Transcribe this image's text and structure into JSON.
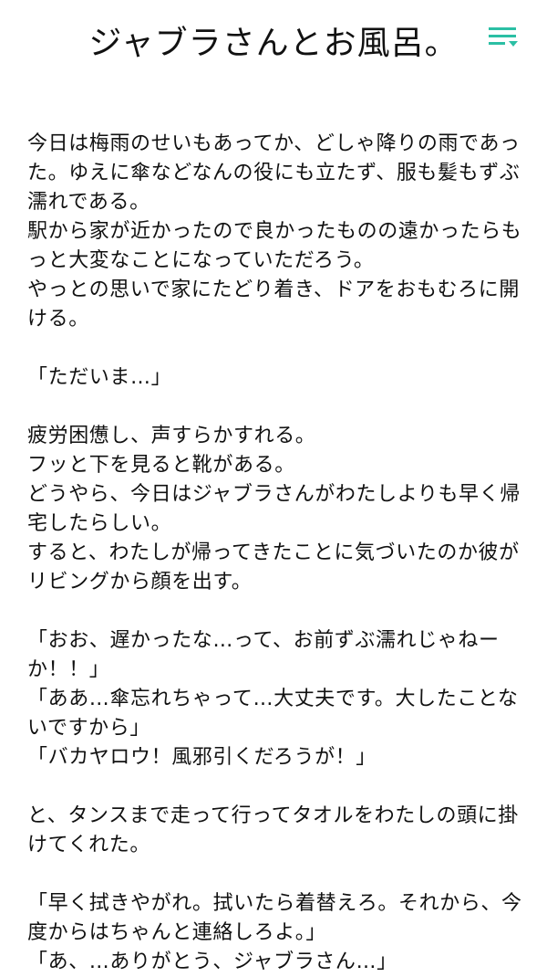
{
  "header": {
    "title": "ジャブラさんとお風呂。",
    "menu_icon": "menu-lines-with-down-arrow-icon",
    "accent_color": "#2bbfa4"
  },
  "story": {
    "paragraphs": [
      "今日は梅雨のせいもあってか、どしゃ降りの雨であった。ゆえに傘などなんの役にも立たず、服も髪もずぶ濡れである。\n駅から家が近かったので良かったものの遠かったらもっと大変なことになっていただろう。\nやっとの思いで家にたどり着き、ドアをおもむろに開ける。",
      "「ただいま…」",
      "疲労困憊し、声すらかすれる。\nフッと下を見ると靴がある。\nどうやら、今日はジャブラさんがわたしよりも早く帰宅したらしい。\nすると、わたしが帰ってきたことに気づいたのか彼がリビングから顔を出す。",
      "「おお、遅かったな…って、お前ずぶ濡れじゃねーか！！」\n「ああ…傘忘れちゃって…大丈夫です。大したことないですから」\n「バカヤロウ！風邪引くだろうが！」",
      "と、タンスまで走って行ってタオルをわたしの頭に掛けてくれた。",
      "「早く拭きやがれ。拭いたら着替えろ。それから、今度からはちゃんと連絡しろよ。」\n「あ、…ありがとう、ジャブラさん…」"
    ]
  }
}
